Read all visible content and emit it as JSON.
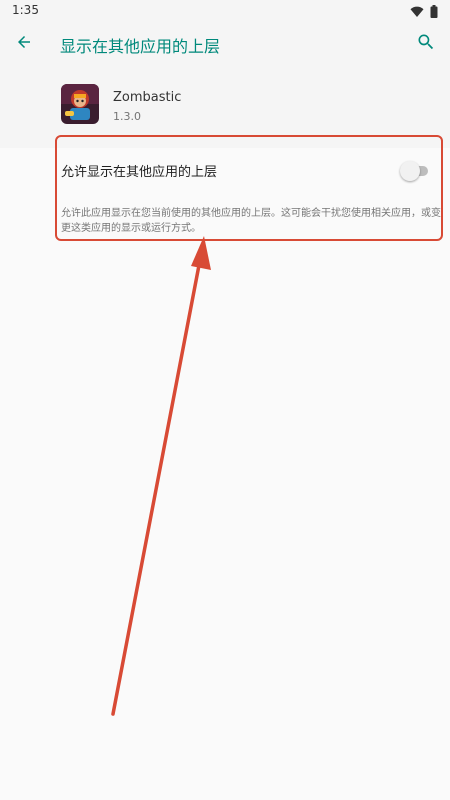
{
  "status_bar": {
    "time": "1:35",
    "icons": [
      "wifi-icon",
      "battery-icon"
    ]
  },
  "app_bar": {
    "back_icon": "arrow-back-icon",
    "title": "显示在其他应用的上层",
    "search_icon": "search-icon"
  },
  "app": {
    "name": "Zombastic",
    "version": "1.3.0",
    "icon": "zombastic-app-icon"
  },
  "setting": {
    "title": "允许显示在其他应用的上层",
    "enabled": false,
    "description": "允许此应用显示在您当前使用的其他应用的上层。这可能会干扰您使用相关应用，或变更这类应用的显示或运行方式。"
  },
  "colors": {
    "accent": "#00897b",
    "annotation": "#d84a35",
    "background": "#fafafa",
    "toggle_off_track": "#bdbdbd",
    "toggle_off_thumb": "#f1f1f1"
  }
}
